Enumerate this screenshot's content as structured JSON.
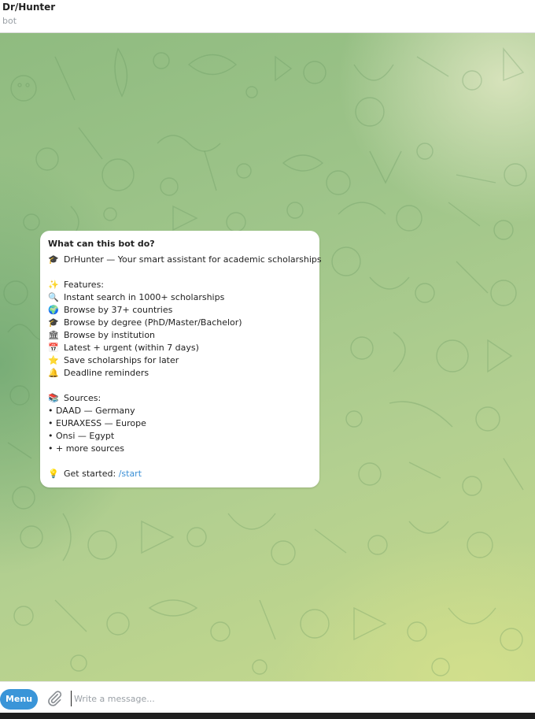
{
  "header": {
    "title": "Dr/Hunter",
    "subtitle": "bot"
  },
  "card": {
    "title": "What can this bot do?",
    "intro": {
      "icon": "🎓",
      "text": "DrHunter — Your smart assistant for academic scholarships"
    },
    "features_header": {
      "icon": "✨",
      "text": "Features:"
    },
    "features": [
      {
        "icon": "🔍",
        "text": "Instant search in 1000+ scholarships"
      },
      {
        "icon": "🌍",
        "text": "Browse by 37+ countries"
      },
      {
        "icon": "🎓",
        "text": "Browse by degree (PhD/Master/Bachelor)"
      },
      {
        "icon": "🏛",
        "text": "Browse by institution"
      },
      {
        "icon": "📅",
        "text": "Latest + urgent (within 7 days)"
      },
      {
        "icon": "⭐",
        "text": "Save scholarships for later"
      },
      {
        "icon": "🔔",
        "text": "Deadline reminders"
      }
    ],
    "sources_header": {
      "icon": "📚",
      "text": "Sources:"
    },
    "sources": [
      "• DAAD — Germany",
      "• EURAXESS — Europe",
      "• Onsi — Egypt",
      "• + more sources"
    ],
    "get_started": {
      "icon": "💡",
      "text": "Get started:",
      "command": "/start"
    }
  },
  "composer": {
    "menu_label": "Menu",
    "attach_icon": "paperclip-icon",
    "placeholder": "Write a message..."
  },
  "colors": {
    "accent": "#3a95d8",
    "link": "#3a8fd6"
  }
}
